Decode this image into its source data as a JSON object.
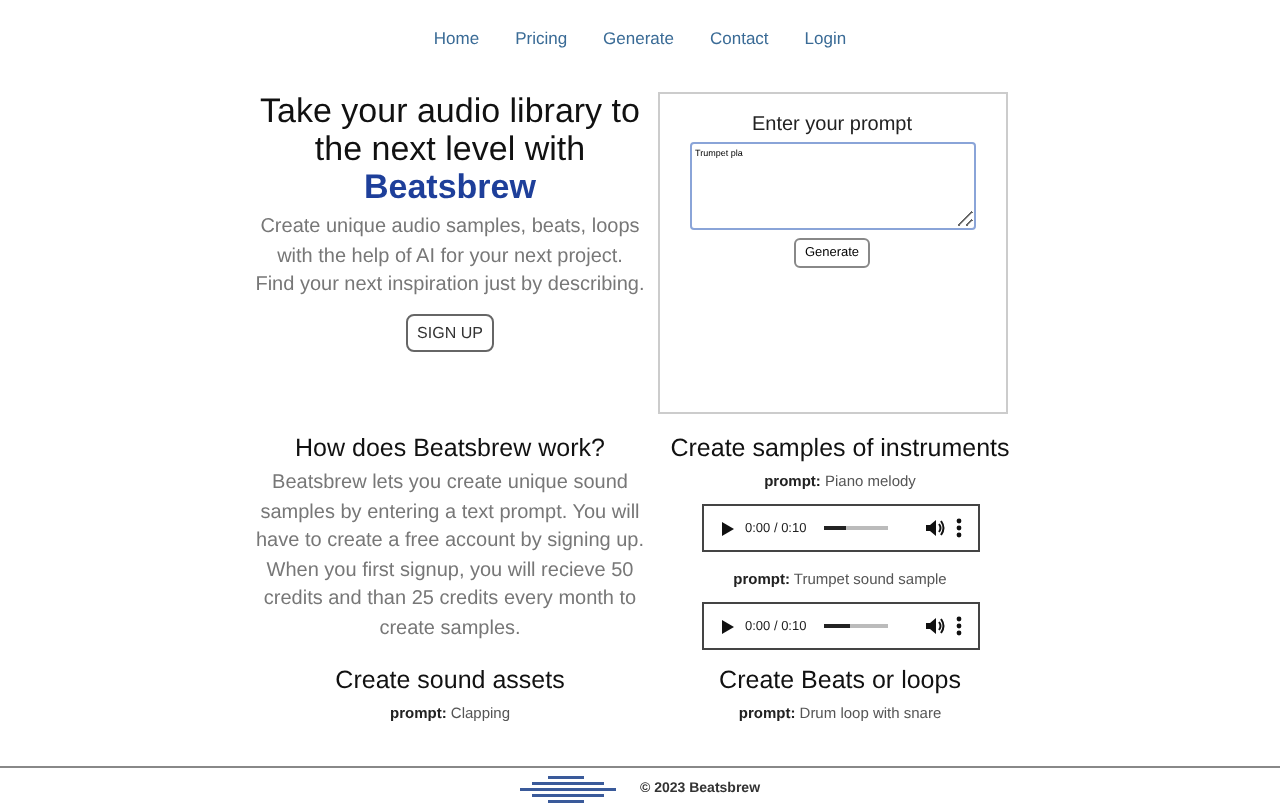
{
  "nav": [
    "Home",
    "Pricing",
    "Generate",
    "Contact",
    "Login"
  ],
  "hero": {
    "heading": "Take your audio library to the next level with",
    "brand": "Beatsbrew",
    "text": "Create unique audio samples, beats, loops with the help of AI for your next project. Find your next inspiration just by describing.",
    "button": "SIGN UP"
  },
  "prompt_box": {
    "title": "Enter your prompt",
    "value": "Trumpet pla",
    "button": "Generate"
  },
  "how": {
    "title": "How does Beatsbrew work?",
    "text": "Beatsbrew lets you create unique sound samples by entering a text prompt. You will have to create a free account by signing up. When you first signup, you will recieve 50 credits and than 25 credits every month to create samples."
  },
  "instruments": {
    "title": "Create samples of instruments",
    "samples": [
      {
        "label": "prompt:",
        "prompt": "Piano melody",
        "time": "0:00 / 0:10",
        "level": 0.35
      },
      {
        "label": "prompt:",
        "prompt": "Trumpet sound sample",
        "time": "0:00 / 0:10",
        "level": 0.4
      }
    ]
  },
  "assets": {
    "title": "Create sound assets",
    "label": "prompt:",
    "prompt": "Clapping"
  },
  "beats": {
    "title": "Create Beats or loops",
    "label": "prompt:",
    "prompt": "Drum loop with snare"
  },
  "footer": {
    "text": "© 2023 Beatsbrew"
  }
}
